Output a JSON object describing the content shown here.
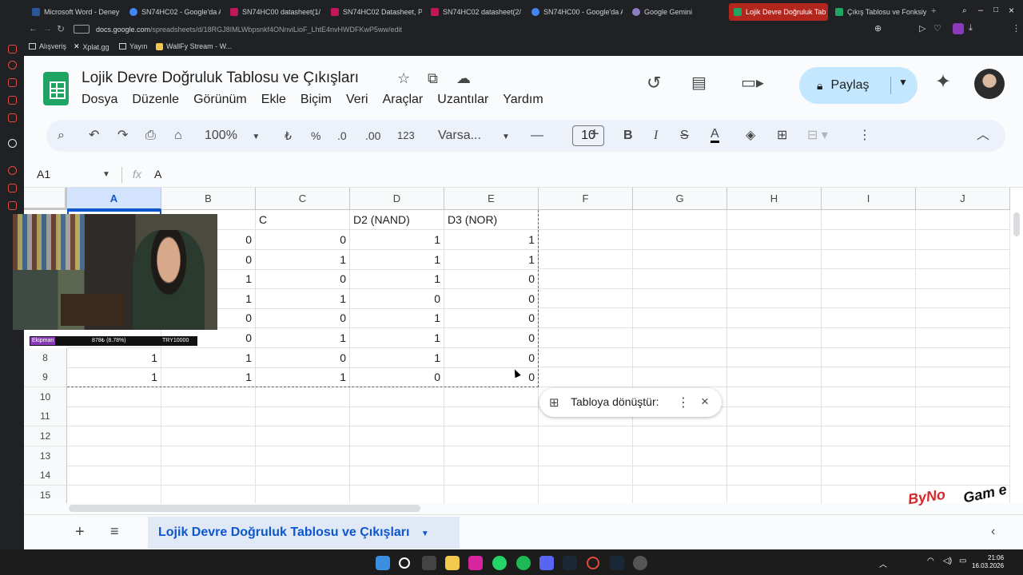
{
  "browser": {
    "tabs": [
      {
        "label": "Microsoft Word - Deney",
        "color": "#2b579a"
      },
      {
        "label": "SN74HC02 - Google'da A",
        "color": "#4285f4"
      },
      {
        "label": "SN74HC00 datasheet(1/",
        "color": "#c2185b"
      },
      {
        "label": "SN74HC02 Datasheet, PD",
        "color": "#c2185b"
      },
      {
        "label": "SN74HC02 datasheet(2/",
        "color": "#c2185b"
      },
      {
        "label": "SN74HC00 - Google'da A",
        "color": "#4285f4"
      },
      {
        "label": "Google Gemini",
        "color": "#8e7cc3"
      },
      {
        "label": "Lojik Devre Doğruluk Tab",
        "color": "#1fa463"
      },
      {
        "label": "Çıkış Tablosu ve Fonksiyo",
        "color": "#1fa463"
      }
    ],
    "url_host": "docs.google.com",
    "url_path": "/spreadsheets/d/18RGJ8IMLWbpsnkf4ONnviLioF_LhtE4nvHWDFKwP5ww/edit",
    "bookmarks": [
      "Alışveriş",
      "Xplat.gg",
      "Yayın",
      "WallFy Stream - W..."
    ]
  },
  "sheets": {
    "title": "Lojik Devre Doğruluk Tablosu ve Çıkışları",
    "menus": [
      "Dosya",
      "Düzenle",
      "Görünüm",
      "Ekle",
      "Biçim",
      "Veri",
      "Araçlar",
      "Uzantılar",
      "Yardım"
    ],
    "share_label": "Paylaş",
    "toolbar": {
      "zoom": "100%",
      "currency": "₺",
      "percent": "%",
      "dec_less": ".0",
      "dec_more": ".00",
      "format_123": "123",
      "font": "Varsa...",
      "font_size": "10"
    },
    "name_box": "A1",
    "fx": "fx",
    "formula_value": "A",
    "columns": [
      "A",
      "B",
      "C",
      "D",
      "E",
      "F",
      "G",
      "H",
      "I",
      "J"
    ],
    "row_numbers": [
      "8",
      "9",
      "10",
      "11",
      "12",
      "13",
      "14",
      "15"
    ],
    "header_row": {
      "c": "C",
      "d": "D2 (NAND)",
      "e": "D3 (NOR)"
    },
    "rows": [
      {
        "a": "",
        "b": "0",
        "c": "0",
        "d": "1",
        "e": "1"
      },
      {
        "a": "",
        "b": "0",
        "c": "1",
        "d": "1",
        "e": "1"
      },
      {
        "a": "",
        "b": "1",
        "c": "0",
        "d": "1",
        "e": "0"
      },
      {
        "a": "",
        "b": "1",
        "c": "1",
        "d": "0",
        "e": "0"
      },
      {
        "a": "",
        "b": "0",
        "c": "0",
        "d": "1",
        "e": "0"
      },
      {
        "a": "",
        "b": "0",
        "c": "1",
        "d": "1",
        "e": "0"
      },
      {
        "a": "1",
        "b": "1",
        "c": "0",
        "d": "1",
        "e": "0"
      },
      {
        "a": "1",
        "b": "1",
        "c": "1",
        "d": "0",
        "e": "0"
      }
    ],
    "popup_label": "Tabloya dönüştür:",
    "sheet_tab": "Lojik Devre Doğruluk Tablosu ve Çıkışları"
  },
  "overlay": {
    "ekip_tag": "Ekipman",
    "ekip_stat": "878₺ (8.78%)",
    "ekip_goal": "TRY10000",
    "brand": "ByNo",
    "brand2": "Gam e"
  },
  "taskbar": {
    "time": "21:06",
    "date": "16.03.2026"
  }
}
